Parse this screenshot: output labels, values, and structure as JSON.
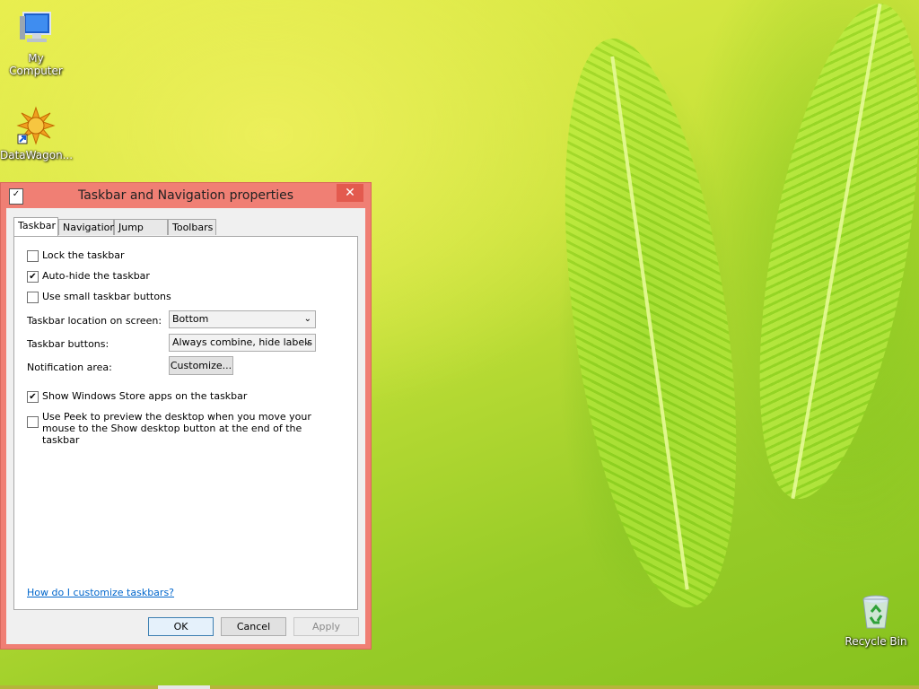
{
  "desktop": {
    "icons": [
      {
        "label": "My Computer",
        "icon": "computer-icon"
      },
      {
        "label": "DataWagon...",
        "icon": "datawagon-icon"
      },
      {
        "label": "Recycle Bin",
        "icon": "recycle-bin-icon"
      }
    ]
  },
  "dialog": {
    "title": "Taskbar and Navigation properties",
    "close_glyph": "✕",
    "tabs": [
      "Taskbar",
      "Navigation",
      "Jump Lists",
      "Toolbars"
    ],
    "active_tab": "Taskbar",
    "options": {
      "lock_taskbar": {
        "label": "Lock the taskbar",
        "checked": false
      },
      "auto_hide": {
        "label": "Auto-hide the taskbar",
        "checked": true
      },
      "small_buttons": {
        "label": "Use small taskbar buttons",
        "checked": false
      },
      "store_apps": {
        "label": "Show Windows Store apps on the taskbar",
        "checked": true
      },
      "peek": {
        "label": "Use Peek to preview the desktop when you move your mouse to the Show desktop button at the end of the taskbar",
        "checked": false
      }
    },
    "location": {
      "label": "Taskbar location on screen:",
      "value": "Bottom"
    },
    "buttons_setting": {
      "label": "Taskbar buttons:",
      "value": "Always combine, hide labels"
    },
    "notification": {
      "label": "Notification area:",
      "button": "Customize..."
    },
    "help_link": "How do I customize taskbars?",
    "footer": {
      "ok": "OK",
      "cancel": "Cancel",
      "apply": "Apply"
    }
  },
  "check_glyph": "✔"
}
